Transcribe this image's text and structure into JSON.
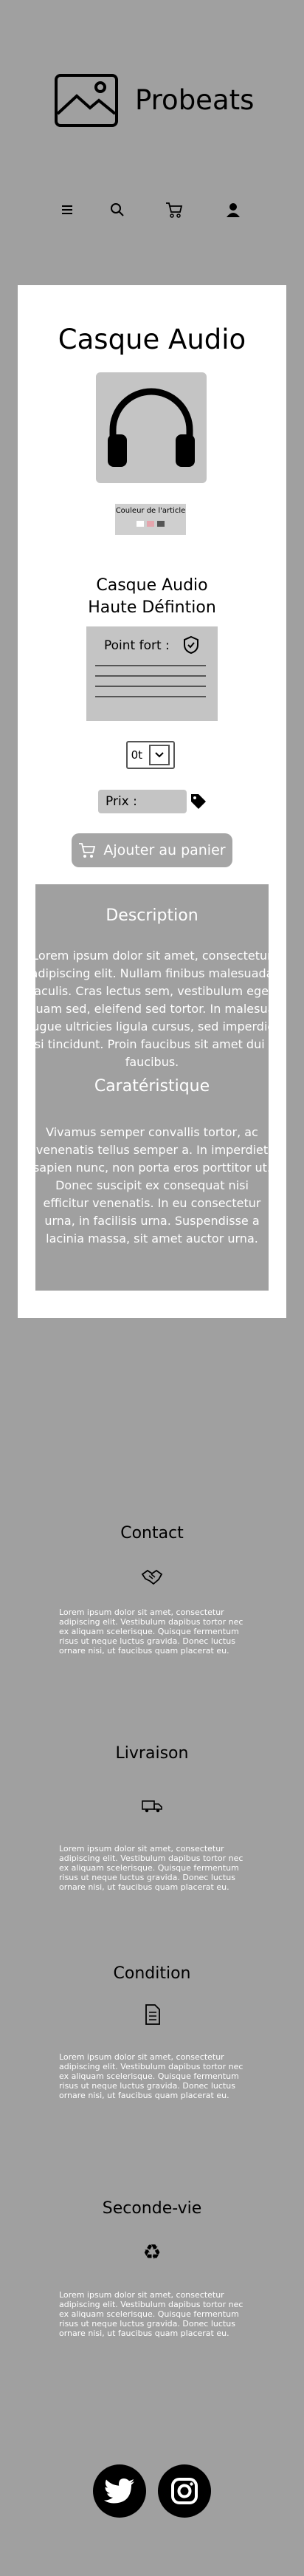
{
  "header": {
    "brand": "Probeats",
    "logo_icon": "image-placeholder-icon",
    "nav": {
      "menu_icon": "menu-icon",
      "search_icon": "search-icon",
      "cart_icon": "cart-icon",
      "account_icon": "user-icon"
    }
  },
  "product": {
    "page_title": "Casque Audio",
    "image_icon": "headphones-icon",
    "colors_label": "Couleur de l'article",
    "swatches": [
      "#ffffff",
      "#e4a5ad",
      "#555555"
    ],
    "name_line1": "Casque Audio",
    "name_line2": "Haute Défintion",
    "features_label": "Point fort :",
    "quantity": "0t",
    "price_label": "Prix :",
    "add_to_cart": "Ajouter au panier"
  },
  "description": {
    "title": "Description",
    "text": "Lorem ipsum dolor sit amet, consectetur adipiscing elit. Nullam finibus malesuada iaculis. Cras lectus sem, vestibulum eget aliquam sed, eleifend sed tortor. In malesuada augue ultricies ligula cursus, sed imperdiet nisi tincidunt. Proin faucibus sit amet dui at faucibus.",
    "subtitle": "Caratéristique",
    "text2": "Vivamus semper convallis tortor, ac venenatis tellus semper a. In imperdiet sapien nunc, non porta eros porttitor ut. Donec suscipit ex consequat nisi efficitur venenatis. In eu consectetur urna, in facilisis urna. Suspendisse a lacinia massa, sit amet auctor urna."
  },
  "sections": [
    {
      "title": "Contact",
      "icon": "handshake-icon",
      "text": "Lorem ipsum dolor sit amet, consectetur adipiscing elit. Vestibulum dapibus tortor nec ex aliquam scelerisque. Quisque fermentum risus ut neque luctus gravida. Donec luctus ornare nisi, ut faucibus quam placerat eu."
    },
    {
      "title": "Livraison",
      "icon": "truck-icon",
      "text": "Lorem ipsum dolor sit amet, consectetur adipiscing elit. Vestibulum dapibus tortor nec ex aliquam scelerisque. Quisque fermentum risus ut neque luctus gravida. Donec luctus ornare nisi, ut faucibus quam placerat eu."
    },
    {
      "title": "Condition",
      "icon": "document-icon",
      "text": "Lorem ipsum dolor sit amet, consectetur adipiscing elit. Vestibulum dapibus tortor nec ex aliquam scelerisque. Quisque fermentum risus ut neque luctus gravida. Donec luctus ornare nisi, ut faucibus quam placerat eu."
    },
    {
      "title": "Seconde-vie",
      "icon": "recycle-icon",
      "text": "Lorem ipsum dolor sit amet, consectetur adipiscing elit. Vestibulum dapibus tortor nec ex aliquam scelerisque. Quisque fermentum risus ut neque luctus gravida. Donec luctus ornare nisi, ut faucibus quam placerat eu."
    }
  ],
  "social": {
    "twitter_icon": "twitter-icon",
    "instagram_icon": "instagram-icon"
  }
}
